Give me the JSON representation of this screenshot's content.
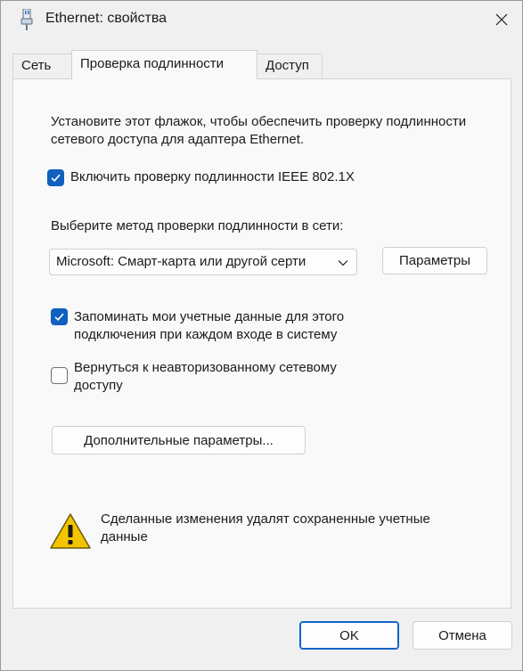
{
  "window": {
    "title": "Ethernet: свойства"
  },
  "tabs": [
    {
      "label": "Сеть"
    },
    {
      "label": "Проверка подлинности"
    },
    {
      "label": "Доступ"
    }
  ],
  "panel": {
    "description": "Установите этот флажок, чтобы обеспечить проверку подлинности сетевого доступа для адаптера Ethernet.",
    "enable_8021x": {
      "label": "Включить проверку подлинности IEEE 802.1X",
      "checked": true
    },
    "method_label": "Выберите метод проверки подлинности в сети:",
    "method_select": {
      "value": "Microsoft: Смарт-карта или другой серти"
    },
    "params_button": "Параметры",
    "remember_creds": {
      "label_line1": "Запоминать мои учетные данные для этого",
      "label_line2": "подключения при каждом входе в систему",
      "checked": true
    },
    "fallback": {
      "label_line1": "Вернуться к неавторизованному сетевому",
      "label_line2": "доступу",
      "checked": false
    },
    "advanced_button": "Дополнительные параметры...",
    "warning": {
      "line1": "Сделанные изменения удалят сохраненные учетные",
      "line2": "данные"
    }
  },
  "footer": {
    "ok": "OK",
    "cancel": "Отмена"
  },
  "colors": {
    "accent": "#1060bf",
    "warning": "#f5c400"
  }
}
